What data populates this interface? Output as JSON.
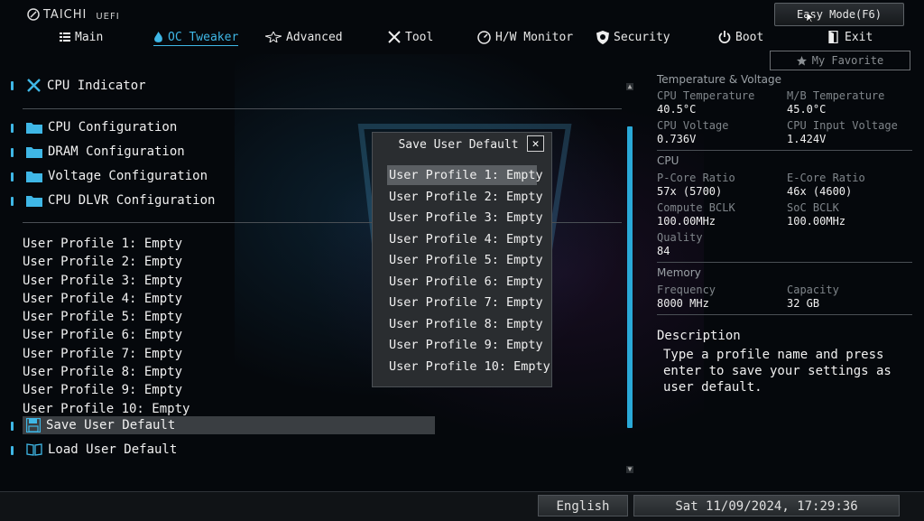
{
  "brand": {
    "name": "TAICHI",
    "sub": "UEFI"
  },
  "easy_mode_label": "Easy Mode(F6)",
  "nav": [
    {
      "label": "Main",
      "icon": "list-icon"
    },
    {
      "label": "OC Tweaker",
      "icon": "flame-icon",
      "active": true
    },
    {
      "label": "Advanced",
      "icon": "star-icon"
    },
    {
      "label": "Tool",
      "icon": "wrench-screwdriver-icon"
    },
    {
      "label": "H/W Monitor",
      "icon": "monitor-gauge-icon"
    },
    {
      "label": "Security",
      "icon": "shield-icon"
    },
    {
      "label": "Boot",
      "icon": "power-icon"
    },
    {
      "label": "Exit",
      "icon": "exit-door-icon"
    }
  ],
  "favorite_label": "My Favorite",
  "left_menu": {
    "cpu_indicator": "CPU Indicator",
    "folders": [
      "CPU Configuration",
      "DRAM Configuration",
      "Voltage Configuration",
      "CPU DLVR Configuration"
    ],
    "profiles": [
      "User Profile 1: Empty",
      "User Profile 2: Empty",
      "User Profile 3: Empty",
      "User Profile 4: Empty",
      "User Profile 5: Empty",
      "User Profile 6: Empty",
      "User Profile 7: Empty",
      "User Profile 8: Empty",
      "User Profile 9: Empty",
      "User Profile 10: Empty"
    ],
    "save_default": "Save User Default",
    "load_default": "Load User Default"
  },
  "dialog": {
    "title": "Save User Default",
    "items": [
      "User Profile 1: Empty",
      "User Profile 2: Empty",
      "User Profile 3: Empty",
      "User Profile 4: Empty",
      "User Profile 5: Empty",
      "User Profile 6: Empty",
      "User Profile 7: Empty",
      "User Profile 8: Empty",
      "User Profile 9: Empty",
      "User Profile 10: Empty"
    ],
    "selected_index": 0
  },
  "right_panel": {
    "temp_voltage_heading": "Temperature & Voltage",
    "cpu_temp_label": "CPU Temperature",
    "cpu_temp_value": "40.5°C",
    "mb_temp_label": "M/B Temperature",
    "mb_temp_value": "45.0°C",
    "cpu_voltage_label": "CPU Voltage",
    "cpu_voltage_value": "0.736V",
    "cpu_input_voltage_label": "CPU Input Voltage",
    "cpu_input_voltage_value": "1.424V",
    "cpu_heading": "CPU",
    "pcore_label": "P-Core Ratio",
    "pcore_value": "57x (5700)",
    "ecore_label": "E-Core Ratio",
    "ecore_value": "46x (4600)",
    "compute_bclk_label": "Compute BCLK",
    "compute_bclk_value": "100.00MHz",
    "soc_bclk_label": "SoC BCLK",
    "soc_bclk_value": "100.00MHz",
    "quality_label": "Quality",
    "quality_value": "84",
    "memory_heading": "Memory",
    "freq_label": "Frequency",
    "freq_value": "8000 MHz",
    "capacity_label": "Capacity",
    "capacity_value": "32 GB",
    "description_title": "Description",
    "description_text": "Type a profile name and press enter to save your settings as user default."
  },
  "bottom": {
    "language": "English",
    "datetime": "Sat 11/09/2024, 17:29:36"
  },
  "colors": {
    "accent": "#3fb7e6",
    "background": "#05080c",
    "selection": "#5b5f63"
  }
}
